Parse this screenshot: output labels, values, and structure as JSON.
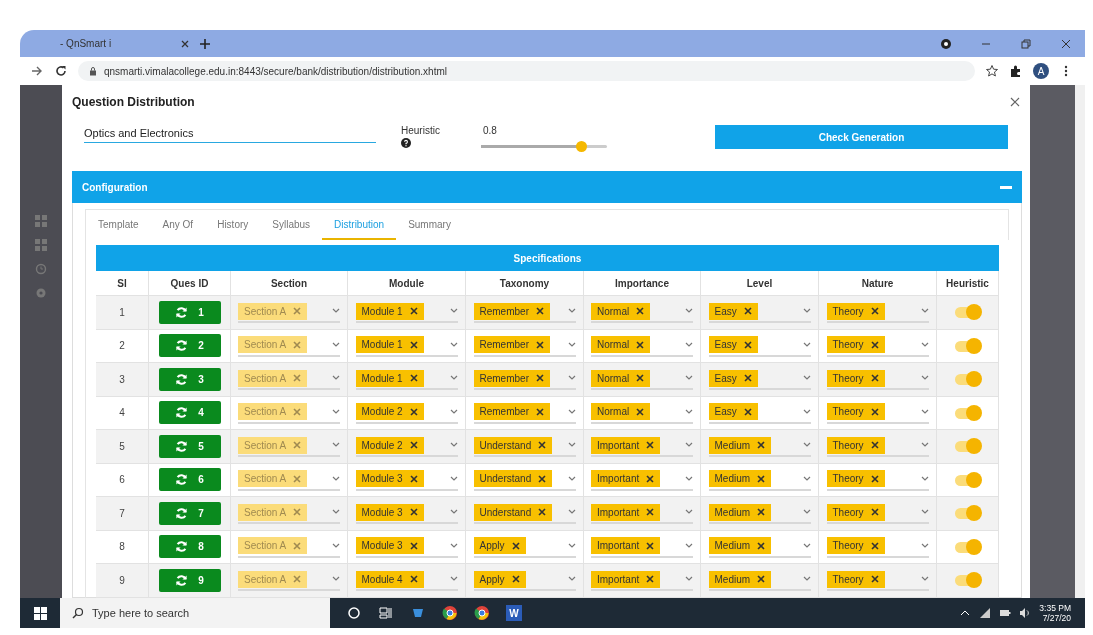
{
  "browser": {
    "tab_title": "- QnSmart i",
    "url": "qnsmarti.vimalacollege.edu.in:8443/secure/bank/distribution/distribution.xhtml",
    "avatar_letter": "A"
  },
  "dialog": {
    "title": "Question Distribution",
    "subject_field": "Optics and Electronics",
    "heuristic_label": "Heuristic",
    "heuristic_value": "0.8",
    "heuristic_slider": {
      "level": 0.79
    },
    "check_button": "Check Generation",
    "panel_title": "Configuration",
    "tabs": [
      {
        "label": "Template",
        "selected": false
      },
      {
        "label": "Any Of",
        "selected": false
      },
      {
        "label": "History",
        "selected": false
      },
      {
        "label": "Syllabus",
        "selected": false
      },
      {
        "label": "Distribution",
        "selected": true
      },
      {
        "label": "Summary",
        "selected": false
      }
    ],
    "table": {
      "title": "Specifications",
      "columns": [
        "Sl",
        "Ques ID",
        "Section",
        "Module",
        "Taxonomy",
        "Importance",
        "Level",
        "Nature",
        "Heuristic"
      ],
      "rows": [
        {
          "sl": "1",
          "ques_id": "1",
          "cells": [
            {
              "text": "Section A",
              "disabled": true
            },
            {
              "text": "Module 1",
              "disabled": false
            },
            {
              "text": "Remember",
              "disabled": false
            },
            {
              "text": "Normal",
              "disabled": false
            },
            {
              "text": "Easy",
              "disabled": false
            },
            {
              "text": "Theory",
              "disabled": false
            }
          ],
          "heuristic_on": true
        },
        {
          "sl": "2",
          "ques_id": "2",
          "cells": [
            {
              "text": "Section A",
              "disabled": true
            },
            {
              "text": "Module 1",
              "disabled": false
            },
            {
              "text": "Remember",
              "disabled": false
            },
            {
              "text": "Normal",
              "disabled": false
            },
            {
              "text": "Easy",
              "disabled": false
            },
            {
              "text": "Theory",
              "disabled": false
            }
          ],
          "heuristic_on": true
        },
        {
          "sl": "3",
          "ques_id": "3",
          "cells": [
            {
              "text": "Section A",
              "disabled": true
            },
            {
              "text": "Module 1",
              "disabled": false
            },
            {
              "text": "Remember",
              "disabled": false
            },
            {
              "text": "Normal",
              "disabled": false
            },
            {
              "text": "Easy",
              "disabled": false
            },
            {
              "text": "Theory",
              "disabled": false
            }
          ],
          "heuristic_on": true
        },
        {
          "sl": "4",
          "ques_id": "4",
          "cells": [
            {
              "text": "Section A",
              "disabled": true
            },
            {
              "text": "Module 2",
              "disabled": false
            },
            {
              "text": "Remember",
              "disabled": false
            },
            {
              "text": "Normal",
              "disabled": false
            },
            {
              "text": "Easy",
              "disabled": false
            },
            {
              "text": "Theory",
              "disabled": false
            }
          ],
          "heuristic_on": true
        },
        {
          "sl": "5",
          "ques_id": "5",
          "cells": [
            {
              "text": "Section A",
              "disabled": true
            },
            {
              "text": "Module 2",
              "disabled": false
            },
            {
              "text": "Understand",
              "disabled": false
            },
            {
              "text": "Important",
              "disabled": false
            },
            {
              "text": "Medium",
              "disabled": false
            },
            {
              "text": "Theory",
              "disabled": false
            }
          ],
          "heuristic_on": true
        },
        {
          "sl": "6",
          "ques_id": "6",
          "cells": [
            {
              "text": "Section A",
              "disabled": true
            },
            {
              "text": "Module 3",
              "disabled": false
            },
            {
              "text": "Understand",
              "disabled": false
            },
            {
              "text": "Important",
              "disabled": false
            },
            {
              "text": "Medium",
              "disabled": false
            },
            {
              "text": "Theory",
              "disabled": false
            }
          ],
          "heuristic_on": true
        },
        {
          "sl": "7",
          "ques_id": "7",
          "cells": [
            {
              "text": "Section A",
              "disabled": true
            },
            {
              "text": "Module 3",
              "disabled": false
            },
            {
              "text": "Understand",
              "disabled": false
            },
            {
              "text": "Important",
              "disabled": false
            },
            {
              "text": "Medium",
              "disabled": false
            },
            {
              "text": "Theory",
              "disabled": false
            }
          ],
          "heuristic_on": true
        },
        {
          "sl": "8",
          "ques_id": "8",
          "cells": [
            {
              "text": "Section A",
              "disabled": true
            },
            {
              "text": "Module 3",
              "disabled": false
            },
            {
              "text": "Apply",
              "disabled": false
            },
            {
              "text": "Important",
              "disabled": false
            },
            {
              "text": "Medium",
              "disabled": false
            },
            {
              "text": "Theory",
              "disabled": false
            }
          ],
          "heuristic_on": true
        },
        {
          "sl": "9",
          "ques_id": "9",
          "cells": [
            {
              "text": "Section A",
              "disabled": true
            },
            {
              "text": "Module 4",
              "disabled": false
            },
            {
              "text": "Apply",
              "disabled": false
            },
            {
              "text": "Important",
              "disabled": false
            },
            {
              "text": "Medium",
              "disabled": false
            },
            {
              "text": "Theory",
              "disabled": false
            }
          ],
          "heuristic_on": true
        }
      ]
    }
  },
  "taskbar": {
    "search_placeholder": "Type here to search",
    "word_letter": "W",
    "time": "3:35 PM",
    "date": "7/27/20"
  }
}
